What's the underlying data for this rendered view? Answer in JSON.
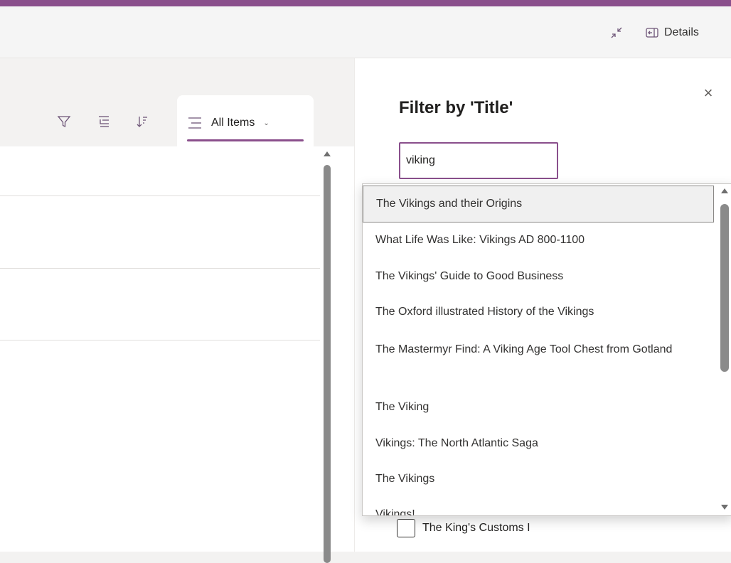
{
  "topbar": {
    "details_label": "Details",
    "collapse_icon": "collapse-arrows-icon",
    "details_icon": "details-pane-icon"
  },
  "commandbar": {
    "filter_icon": "filter-icon",
    "group_icon": "group-by-icon",
    "sort_icon": "sort-icon",
    "view_icon": "view-options-icon",
    "view_label": "All Items",
    "view_chevron": "⌄"
  },
  "filter_panel": {
    "title": "Filter by 'Title'",
    "input_value": "viking",
    "close_glyph": "×"
  },
  "suggestions": [
    "The Vikings and their Origins",
    "What Life Was Like: Vikings AD 800-1100",
    "The Vikings' Guide to Good Business",
    "The Oxford illustrated History of the Vikings",
    "The Mastermyr Find: A Viking Age Tool Chest from Gotland",
    "The Viking",
    "Vikings: The North Atlantic Saga",
    "The Vikings",
    "Vikings!"
  ],
  "checkbox_item": {
    "label": "The King's Customs I",
    "checked": false
  },
  "colors": {
    "accent": "#8a4f8c",
    "icon": "#6d5477"
  }
}
